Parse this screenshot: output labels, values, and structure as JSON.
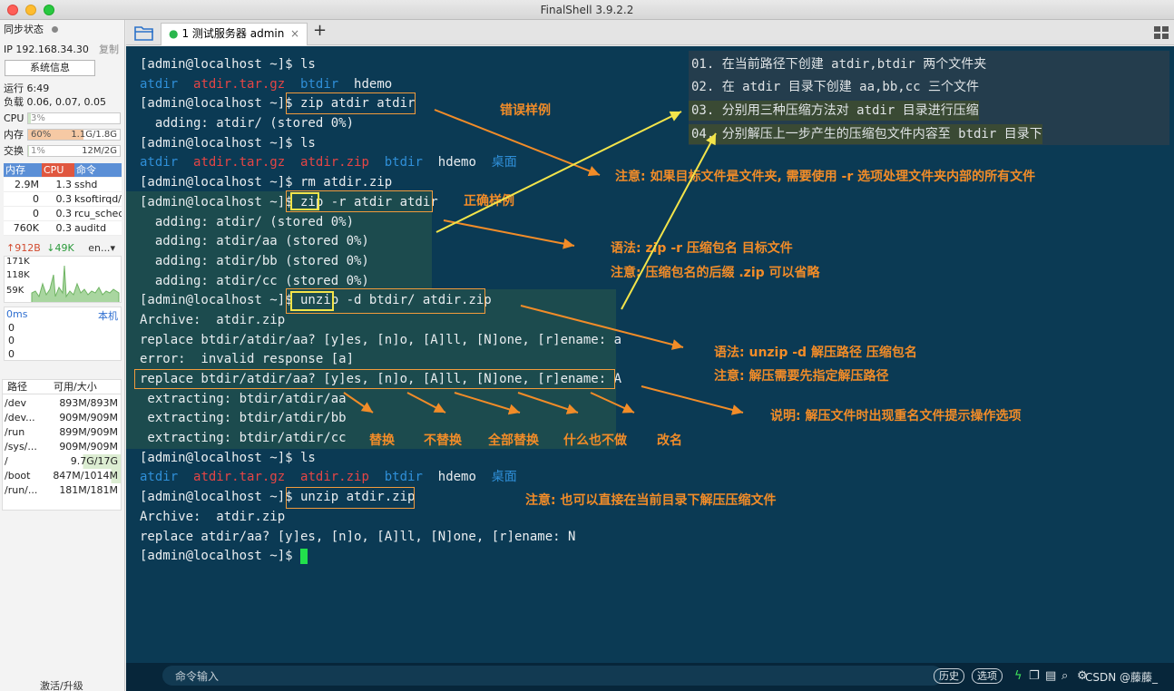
{
  "window": {
    "title": "FinalShell 3.9.2.2"
  },
  "sidebar": {
    "sync_label": "同步状态",
    "ip_label": "IP 192.168.34.30",
    "copy_label": "复制",
    "sysinfo_button": "系统信息",
    "uptime": "运行 6:49",
    "load": "负载 0.06, 0.07, 0.05",
    "cpu_label": "CPU",
    "cpu_value": "3%",
    "cpu_fraction": 0.03,
    "mem_label": "内存",
    "mem_percent": "60%",
    "mem_value": "1.1G/1.8G",
    "mem_fraction": 0.6,
    "swap_label": "交换",
    "swap_percent": "1%",
    "swap_value": "12M/2G",
    "swap_fraction": 0.01,
    "proc_headers": [
      "内存",
      "CPU",
      "命令"
    ],
    "processes": [
      {
        "mem": "2.9M",
        "cpu": "1.3",
        "cmd": "sshd"
      },
      {
        "mem": "0",
        "cpu": "0.3",
        "cmd": "ksoftirqd/"
      },
      {
        "mem": "0",
        "cpu": "0.3",
        "cmd": "rcu_sched"
      },
      {
        "mem": "760K",
        "cpu": "0.3",
        "cmd": "auditd"
      }
    ],
    "net_up": "912B",
    "net_down": "49K",
    "net_iface": "en...",
    "net_scale": [
      "171K",
      "118K",
      "59K"
    ],
    "latency_label": "0ms",
    "latency_host": "本机",
    "latency_vals": [
      "0",
      "0",
      "0"
    ],
    "disk_headers": [
      "路径",
      "可用/大小"
    ],
    "disks": [
      {
        "path": "/dev",
        "size": "893M/893M"
      },
      {
        "path": "/dev...",
        "size": "909M/909M"
      },
      {
        "path": "/run",
        "size": "899M/909M"
      },
      {
        "path": "/sys/...",
        "size": "909M/909M"
      },
      {
        "path": "/",
        "size": "9.7G/17G"
      },
      {
        "path": "/boot",
        "size": "847M/1014M"
      },
      {
        "path": "/run/...",
        "size": "181M/181M"
      }
    ],
    "upgrade_label": "激活/升级"
  },
  "tabs": [
    {
      "label": "1 测试服务器 admin",
      "close": "×"
    }
  ],
  "terminal": {
    "lines": [
      [
        {
          "t": "[admin@localhost ~]$ ls",
          "c": "white"
        }
      ],
      [
        {
          "t": "atdir",
          "c": "blue"
        },
        {
          "t": "  ",
          "c": "white"
        },
        {
          "t": "atdir.tar.gz",
          "c": "red"
        },
        {
          "t": "  ",
          "c": "white"
        },
        {
          "t": "btdir",
          "c": "blue"
        },
        {
          "t": "  hdemo",
          "c": "white"
        }
      ],
      [
        {
          "t": "[admin@localhost ~]$ zip atdir atdir",
          "c": "white"
        }
      ],
      [
        {
          "t": "  adding: atdir/ (stored 0%)",
          "c": "white"
        }
      ],
      [
        {
          "t": "[admin@localhost ~]$ ls",
          "c": "white"
        }
      ],
      [
        {
          "t": "atdir",
          "c": "blue"
        },
        {
          "t": "  ",
          "c": "white"
        },
        {
          "t": "atdir.tar.gz",
          "c": "red"
        },
        {
          "t": "  ",
          "c": "white"
        },
        {
          "t": "atdir.zip",
          "c": "red"
        },
        {
          "t": "  ",
          "c": "white"
        },
        {
          "t": "btdir",
          "c": "blue"
        },
        {
          "t": "  hdemo  ",
          "c": "white"
        },
        {
          "t": "桌面",
          "c": "blue"
        }
      ],
      [
        {
          "t": "[admin@localhost ~]$ rm atdir.zip",
          "c": "white"
        }
      ],
      [
        {
          "t": "[admin@localhost ~]$ zip -r atdir atdir",
          "c": "white"
        }
      ],
      [
        {
          "t": "  adding: atdir/ (stored 0%)",
          "c": "white"
        }
      ],
      [
        {
          "t": "  adding: atdir/aa (stored 0%)",
          "c": "white"
        }
      ],
      [
        {
          "t": "  adding: atdir/bb (stored 0%)",
          "c": "white"
        }
      ],
      [
        {
          "t": "  adding: atdir/cc (stored 0%)",
          "c": "white"
        }
      ],
      [
        {
          "t": "[admin@localhost ~]$ unzip -d btdir/ atdir.zip",
          "c": "white"
        }
      ],
      [
        {
          "t": "Archive:  atdir.zip",
          "c": "white"
        }
      ],
      [
        {
          "t": "replace btdir/atdir/aa? [y]es, [n]o, [A]ll, [N]one, [r]ename: a",
          "c": "white"
        }
      ],
      [
        {
          "t": "error:  invalid response [a]",
          "c": "white"
        }
      ],
      [
        {
          "t": "replace btdir/atdir/aa? [y]es, [n]o, [A]ll, [N]one, [r]ename: A",
          "c": "white"
        }
      ],
      [
        {
          "t": " extracting: btdir/atdir/aa",
          "c": "white"
        }
      ],
      [
        {
          "t": " extracting: btdir/atdir/bb",
          "c": "white"
        }
      ],
      [
        {
          "t": " extracting: btdir/atdir/cc",
          "c": "white"
        }
      ],
      [
        {
          "t": "[admin@localhost ~]$ ls",
          "c": "white"
        }
      ],
      [
        {
          "t": "atdir",
          "c": "blue"
        },
        {
          "t": "  ",
          "c": "white"
        },
        {
          "t": "atdir.tar.gz",
          "c": "red"
        },
        {
          "t": "  ",
          "c": "white"
        },
        {
          "t": "atdir.zip",
          "c": "red"
        },
        {
          "t": "  ",
          "c": "white"
        },
        {
          "t": "btdir",
          "c": "blue"
        },
        {
          "t": "  hdemo  ",
          "c": "white"
        },
        {
          "t": "桌面",
          "c": "blue"
        }
      ],
      [
        {
          "t": "[admin@localhost ~]$ unzip atdir.zip",
          "c": "white"
        }
      ],
      [
        {
          "t": "Archive:  atdir.zip",
          "c": "white"
        }
      ],
      [
        {
          "t": "replace atdir/aa? [y]es, [n]o, [A]ll, [N]one, [r]ename: N",
          "c": "white"
        }
      ],
      [
        {
          "t": "[admin@localhost ~]$ ",
          "c": "white"
        }
      ]
    ]
  },
  "notes": [
    "01. 在当前路径下创建 atdir,btdir 两个文件夹",
    "02. 在 atdir 目录下创建 aa,bb,cc 三个文件",
    "03. 分别用三种压缩方法对 atdir 目录进行压缩",
    "04. 分别解压上一步产生的压缩包文件内容至 btdir 目录下"
  ],
  "annotations": {
    "wrong": "错误样例",
    "correct": "正确样例",
    "note_dir": "注意: 如果目标文件是文件夹, 需要使用 -r 选项处理文件夹内部的所有文件",
    "zip_syntax": "语法: zip -r 压缩包名 目标文件",
    "zip_note": "注意: 压缩包名的后缀 .zip 可以省略",
    "unzip_syntax": "语法: unzip -d 解压路径 压缩包名",
    "unzip_note": "注意: 解压需要先指定解压路径",
    "rename_note": "说明: 解压文件时出现重名文件提示操作选项",
    "opt_y": "替换",
    "opt_n": "不替换",
    "opt_A": "全部替换",
    "opt_N": "什么也不做",
    "opt_r": "改名",
    "current_dir": "注意: 也可以直接在当前目录下解压压缩文件"
  },
  "cmdbar": {
    "placeholder": "命令输入",
    "history": "历史",
    "options": "选项",
    "csdn": "CSDN @藤藤_"
  },
  "colors": {
    "terminal_bg": "#0b3a54",
    "annotation": "#f28c28",
    "highlight": "#f3e44a",
    "dir_blue": "#2f8fd8",
    "archive_red": "#e54545"
  }
}
